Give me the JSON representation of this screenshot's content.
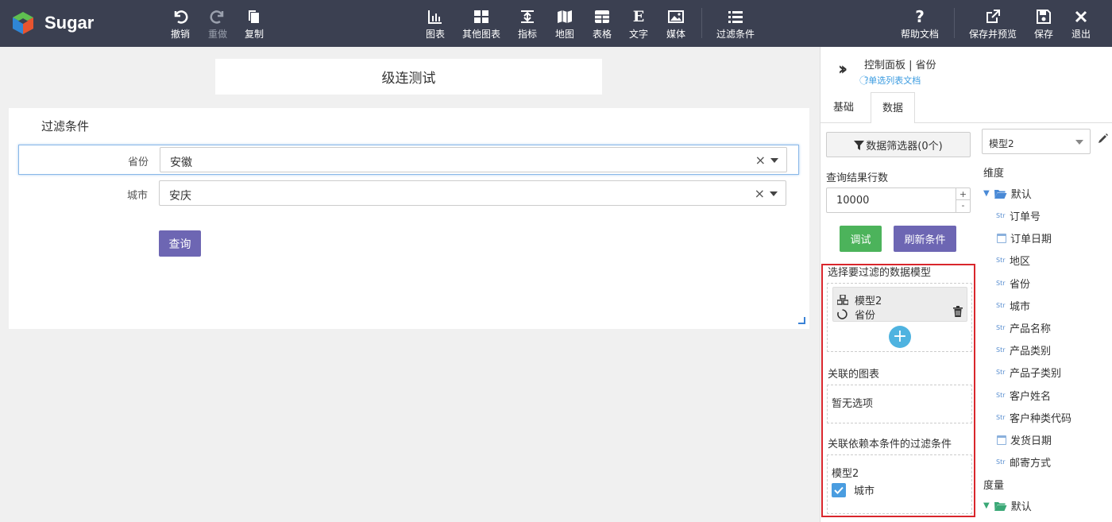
{
  "app": {
    "name": "Sugar"
  },
  "toolbar": {
    "undo": "撤销",
    "redo": "重做",
    "copy": "复制",
    "chart": "图表",
    "other_chart": "其他图表",
    "indicator": "指标",
    "map": "地图",
    "table": "表格",
    "text": "文字",
    "media": "媒体",
    "filter": "过滤条件",
    "help": "帮助文档",
    "save_preview": "保存并预览",
    "save": "保存",
    "exit": "退出",
    "text_glyph": "E"
  },
  "canvas": {
    "title": "级连测试",
    "filter_card": {
      "title": "过滤条件",
      "rows": [
        {
          "label": "省份",
          "value": "安徽"
        },
        {
          "label": "城市",
          "value": "安庆"
        }
      ],
      "query_button": "查询"
    }
  },
  "panel": {
    "title": "控制面板 | 省份",
    "doc_link": "单选列表文档",
    "tabs": [
      "基础",
      "数据"
    ],
    "active_tab": "数据",
    "data_filter_button": "数据筛选器(0个)",
    "query_rows_label": "查询结果行数",
    "query_rows_value": "10000",
    "debug_button": "调试",
    "refresh_button": "刷新条件",
    "select_model_label": "选择要过滤的数据模型",
    "model_item": {
      "model": "模型2",
      "field": "省份"
    },
    "linked_charts_label": "关联的图表",
    "linked_charts_empty": "暂无选项",
    "dependent_label": "关联依赖本条件的过滤条件",
    "dependent_model": "模型2",
    "dependent_field": "城市",
    "model_select_value": "模型2",
    "dimension_label": "维度",
    "dimension_folder": "默认",
    "dimension_fields": [
      {
        "type": "str",
        "name": "订单号"
      },
      {
        "type": "date",
        "name": "订单日期"
      },
      {
        "type": "str",
        "name": "地区"
      },
      {
        "type": "str",
        "name": "省份"
      },
      {
        "type": "str",
        "name": "城市"
      },
      {
        "type": "str",
        "name": "产品名称"
      },
      {
        "type": "str",
        "name": "产品类别"
      },
      {
        "type": "str",
        "name": "产品子类别"
      },
      {
        "type": "str",
        "name": "客户姓名"
      },
      {
        "type": "str",
        "name": "客户种类代码"
      },
      {
        "type": "date",
        "name": "发货日期"
      },
      {
        "type": "str",
        "name": "邮寄方式"
      }
    ],
    "measure_label": "度量",
    "measure_folder": "默认",
    "str_tag": "Str"
  },
  "colors": {
    "topbar": "#3b4051",
    "purple": "#6d66b3",
    "green": "#4cb35b",
    "highlight": "#d9262c",
    "link": "#3a9be0"
  }
}
